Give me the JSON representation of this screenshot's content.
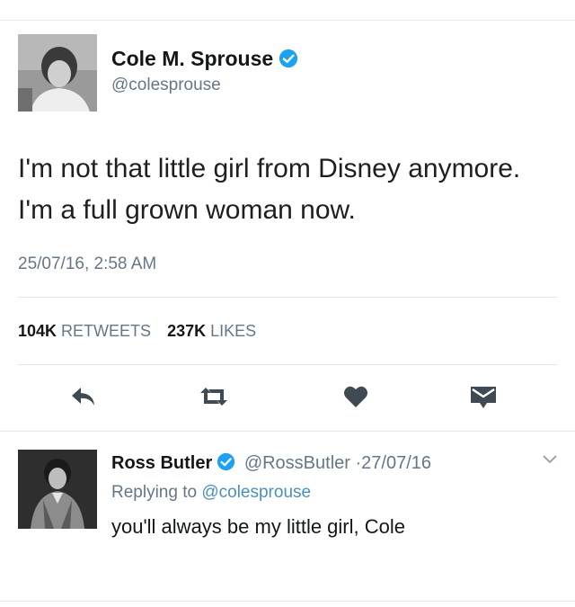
{
  "main_tweet": {
    "author_name": "Cole M. Sprouse",
    "author_handle": "@colesprouse",
    "text": "I'm not that little girl from Disney anymore. I'm a full grown woman now.",
    "timestamp": "25/07/16, 2:58 AM",
    "retweet_count": "104K",
    "retweet_label": "RETWEETS",
    "like_count": "237K",
    "like_label": "LIKES"
  },
  "actions": {
    "reply_icon": "reply-icon",
    "retweet_icon": "retweet-icon",
    "like_icon": "heart-icon",
    "message_icon": "envelope-icon"
  },
  "reply_tweet": {
    "author_name": "Ross Butler",
    "author_handle": "@RossButler",
    "separator": "·",
    "date": "27/07/16",
    "replying_to_prefix": "Replying to",
    "replying_to_handle": "@colesprouse",
    "text": "you'll always be my little girl, Cole"
  },
  "colors": {
    "verified": "#1da1f2",
    "secondary_text": "#657786",
    "mention": "#4a8fbf",
    "icon": "#404a52"
  }
}
